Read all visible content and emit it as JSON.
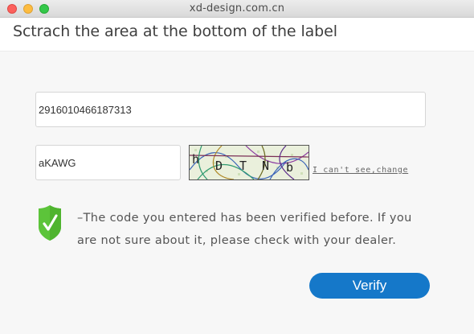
{
  "window": {
    "title": "xd-design.com.cn"
  },
  "header": {
    "title": "Sctrach the area at the bottom of the label"
  },
  "form": {
    "serial_value": "2916010466187313",
    "code_value": "aKAWG",
    "captcha_image_icon": "captcha-image",
    "change_link": "I can't see,change",
    "verify_label": "Verify"
  },
  "result": {
    "status_icon": "shield-check-icon",
    "message": "–The code you entered has been verified before. If you are not sure about it, please check with your dealer."
  },
  "colors": {
    "accent": "#1578c9",
    "shield_green": "#5cc43a"
  }
}
